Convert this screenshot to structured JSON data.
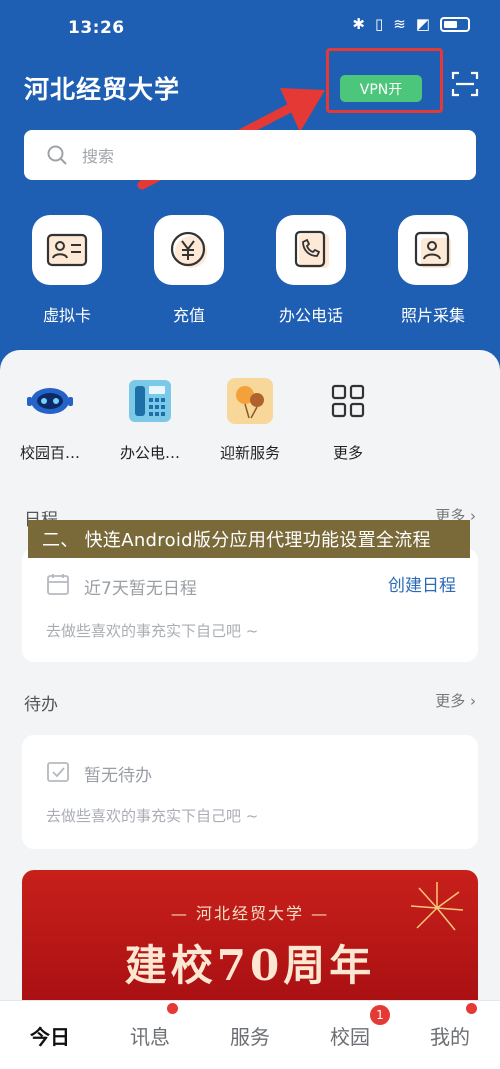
{
  "status_bar": {
    "time": "13:26"
  },
  "header": {
    "title": "河北经贸大学",
    "vpn_label": "VPN开"
  },
  "search": {
    "placeholder": "搜索"
  },
  "quick_actions": [
    {
      "label": "虚拟卡",
      "icon": "virtual-card-icon"
    },
    {
      "label": "充值",
      "icon": "yuan-recharge-icon"
    },
    {
      "label": "办公电话",
      "icon": "office-phone-icon"
    },
    {
      "label": "照片采集",
      "icon": "photo-capture-icon"
    }
  ],
  "services": [
    {
      "label": "校园百…",
      "icon": "robot-icon"
    },
    {
      "label": "办公电…",
      "icon": "desk-phone-icon"
    },
    {
      "label": "迎新服务",
      "icon": "balloons-icon"
    },
    {
      "label": "更多",
      "icon": "grid-more-icon"
    }
  ],
  "overlay_caption": "二、 快连Android版分应用代理功能设置全流程",
  "schedule": {
    "title": "日程",
    "more": "更多 ›",
    "empty_text": "近7天暂无日程",
    "create_label": "创建日程",
    "sub_text": "去做些喜欢的事充实下自己吧 ~"
  },
  "todo": {
    "title": "待办",
    "more": "更多 ›",
    "empty_text": "暂无待办",
    "sub_text": "去做些喜欢的事充实下自己吧 ~"
  },
  "banner": {
    "school": "— 河北经贸大学 —",
    "headline": "建校70周年"
  },
  "tabs": [
    {
      "label": "今日",
      "active": true
    },
    {
      "label": "讯息"
    },
    {
      "label": "服务"
    },
    {
      "label": "校园",
      "badge": "1"
    },
    {
      "label": "我的"
    }
  ],
  "colors": {
    "header_bg": "#1f5fb3",
    "vpn_green": "#4cc67a",
    "highlight_red": "#e53935"
  }
}
